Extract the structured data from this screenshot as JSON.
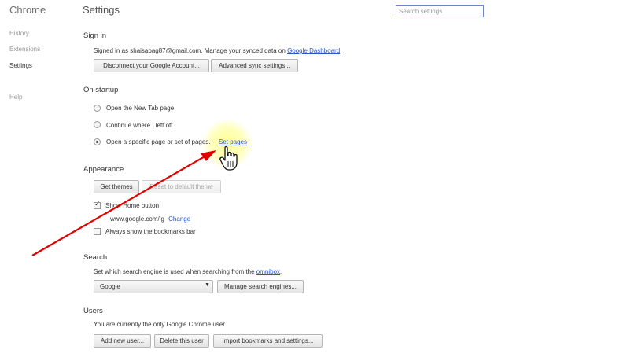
{
  "sidebar": {
    "brand": "Chrome",
    "items": [
      {
        "label": "History"
      },
      {
        "label": "Extensions"
      },
      {
        "label": "Settings"
      },
      {
        "label": "Help"
      }
    ]
  },
  "header": {
    "title": "Settings",
    "search_placeholder": "Search settings"
  },
  "signin": {
    "title": "Sign in",
    "status_text": "Signed in as shaisabag87@gmail.com. Manage your synced data on",
    "dashboard_link": "Google Dashboard",
    "dashboard_suffix": ".",
    "disconnect_button": "Disconnect your Google Account...",
    "advanced_sync_button": "Advanced sync settings..."
  },
  "startup": {
    "title": "On startup",
    "options": [
      {
        "label": "Open the New Tab page",
        "selected": false
      },
      {
        "label": "Continue where I left off",
        "selected": false
      },
      {
        "label": "Open a specific page or set of pages.",
        "selected": true
      }
    ],
    "set_pages_link": "Set pages"
  },
  "appearance": {
    "title": "Appearance",
    "get_themes_button": "Get themes",
    "reset_theme_button": "Reset to default theme",
    "show_home_label": "Show Home button",
    "show_home_checked": true,
    "home_url": "www.google.com/ig",
    "change_link": "Change",
    "bookmarks_bar_label": "Always show the bookmarks bar",
    "bookmarks_bar_checked": false
  },
  "search": {
    "title": "Search",
    "description": "Set which search engine is used when searching from the",
    "omnibox_link": "omnibox",
    "description_suffix": ".",
    "engine_selected": "Google",
    "manage_button": "Manage search engines..."
  },
  "users": {
    "title": "Users",
    "description": "You are currently the only Google Chrome user.",
    "add_user_button": "Add new user...",
    "delete_user_button": "Delete this user",
    "import_button": "Import bookmarks and settings..."
  },
  "annotation": {
    "arrow_color": "#e00000",
    "highlight_color": "#ffff8c"
  }
}
